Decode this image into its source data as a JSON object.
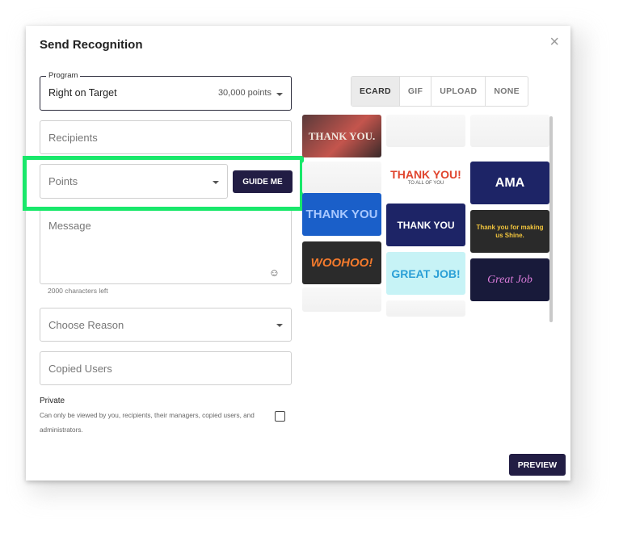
{
  "dialog": {
    "title": "Send Recognition",
    "close": "×"
  },
  "program": {
    "label": "Program",
    "value": "Right on Target",
    "points": "30,000 points"
  },
  "recipients": {
    "placeholder": "Recipients"
  },
  "points": {
    "placeholder": "Points"
  },
  "guide_button": "GUIDE ME",
  "message": {
    "placeholder": "Message",
    "chars_left": "2000 characters left",
    "emoji": "☺"
  },
  "reason": {
    "placeholder": "Choose Reason"
  },
  "copied": {
    "placeholder": "Copied Users"
  },
  "private": {
    "label": "Private",
    "description": "Can only be viewed by you, recipients, their managers, copied users, and administrators."
  },
  "tabs": [
    "ECARD",
    "GIF",
    "UPLOAD",
    "NONE"
  ],
  "active_tab": "ECARD",
  "ecards": [
    "THANK YOU.",
    "THANK YOU!",
    "AMA",
    "THANK YOU",
    "THANK YOU",
    "Thank you for making us Shine.",
    "WOOHOO!",
    "GREAT JOB!",
    "Great Job"
  ],
  "ecard_subtext": {
    "thank_you_all": "TO ALL OF YOU"
  },
  "preview_button": "PREVIEW",
  "colors": {
    "primary": "#221d44",
    "highlight": "#19e86b"
  }
}
